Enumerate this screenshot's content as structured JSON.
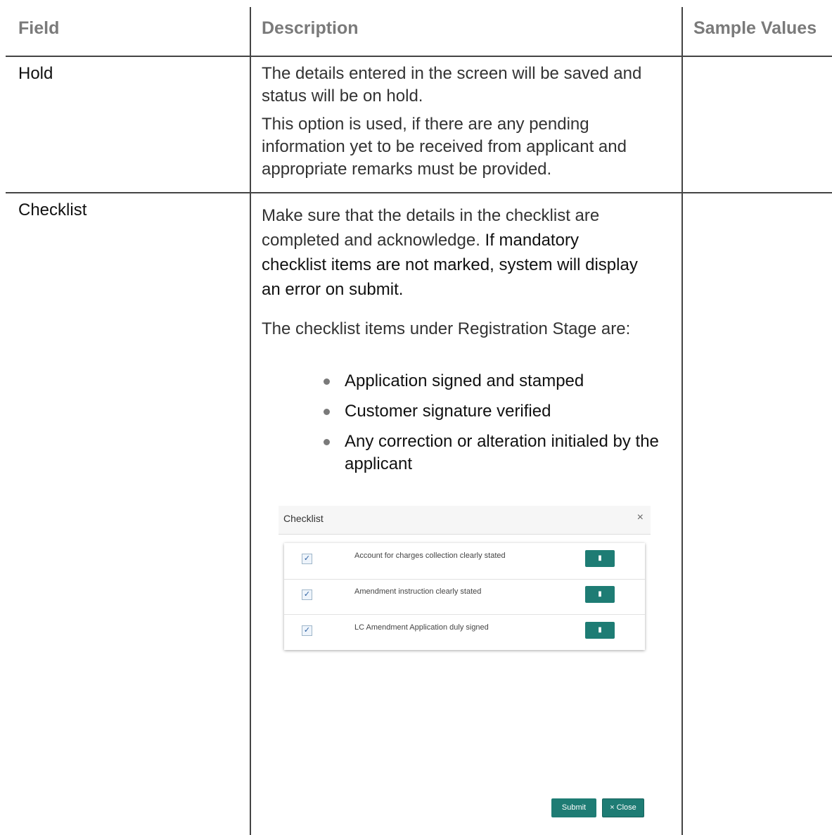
{
  "headers": {
    "field": "Field",
    "description": "Description",
    "sample_values": "Sample Values"
  },
  "rows": [
    {
      "field": "Hold",
      "paragraphs": [
        "The details entered in the screen will be saved and status will be on hold.",
        "This option is used, if there are any pending information yet to be received from applicant and appropriate remarks must be provided."
      ]
    },
    {
      "field": "Checklist",
      "intro_part1": "Make sure that the details in the checklist are completed and acknowledge.",
      "intro_part2": "If mandatory checklist items are not marked, system will display an error on submit.",
      "items_intro": "The checklist items under Registration Stage are:",
      "bullets": [
        "Application signed and stamped",
        "Customer signature verified",
        "Any correction or alteration initialed by the applicant"
      ]
    }
  ],
  "checklist_dialog": {
    "title": "Checklist",
    "close_glyph": "×",
    "items": [
      {
        "label": "Account for charges collection clearly stated",
        "checked": true
      },
      {
        "label": "Amendment instruction clearly stated",
        "checked": true
      },
      {
        "label": "LC Amendment Application duly signed",
        "checked": true
      }
    ],
    "check_glyph": "✓",
    "remark_icon": "comment-icon",
    "submit_label": "Submit",
    "close_label": "× Close",
    "accent_color": "#1e7c74"
  }
}
